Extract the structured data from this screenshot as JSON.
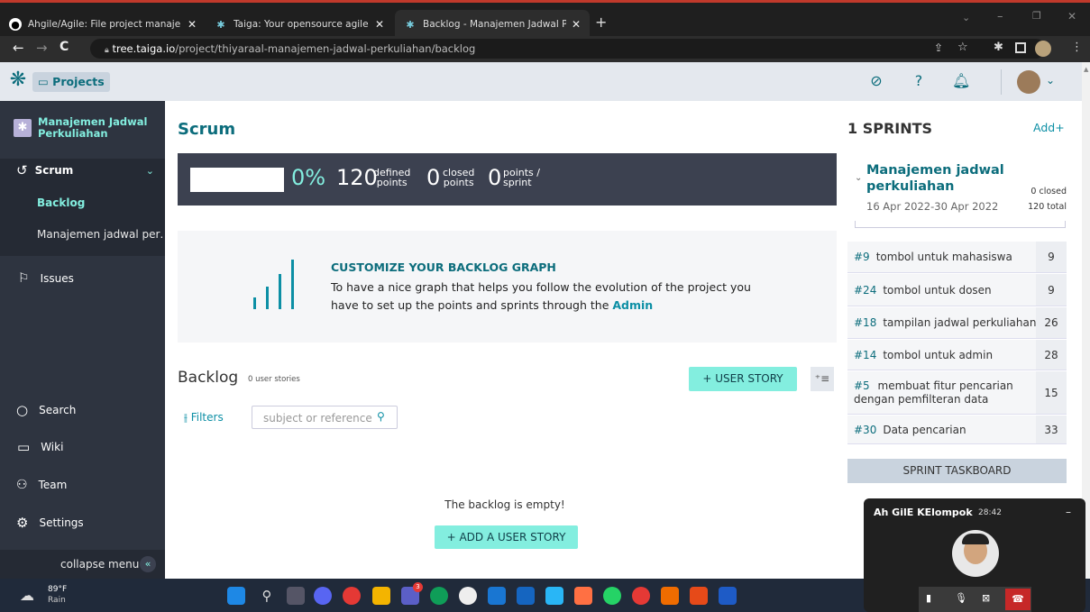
{
  "browser": {
    "tabs": [
      {
        "title": "Ahgile/Agile: File project manaje",
        "icon": "github-icon"
      },
      {
        "title": "Taiga: Your opensource agile proj",
        "icon": "taiga-icon"
      },
      {
        "title": "Backlog - Manajemen Jadwal Per",
        "icon": "taiga-icon"
      }
    ],
    "new_tab": "+",
    "url_host": "tree.taiga.io",
    "url_path": "/project/thiyaraal-manajemen-jadwal-perkuliahan/backlog"
  },
  "topnav": {
    "projects_label": "Projects"
  },
  "sidebar": {
    "project_name": "Manajemen Jadwal Perkuliahan",
    "scrum_label": "Scrum",
    "backlog_label": "Backlog",
    "sprint_label": "Manajemen jadwal per…",
    "issues_label": "Issues",
    "search_label": "Search",
    "wiki_label": "Wiki",
    "team_label": "Team",
    "settings_label": "Settings",
    "collapse_label": "collapse menu"
  },
  "main": {
    "title": "Scrum",
    "progress": {
      "percent": "0%",
      "defined_value": "120",
      "defined_label_1": "defined",
      "defined_label_2": "points",
      "closed_value": "0",
      "closed_label_1": "closed",
      "closed_label_2": "points",
      "sprint_value": "0",
      "sprint_label_1": "points /",
      "sprint_label_2": "sprint"
    },
    "graph": {
      "title": "CUSTOMIZE YOUR BACKLOG GRAPH",
      "text_1": "To have a nice graph that helps you follow the evolution of the project you",
      "text_2": "have to set up the points and sprints through the ",
      "admin_link": "Admin"
    },
    "backlog": {
      "title": "Backlog",
      "count": "0 user stories",
      "add_story": "+  USER STORY",
      "filters": "Filters",
      "search_placeholder": "subject or reference",
      "empty_text": "The backlog is empty!",
      "add_a_story": "+  ADD A USER STORY"
    }
  },
  "sprints": {
    "header": "1 SPRINTS",
    "add": "Add",
    "sprint_name_1": "Manajemen jadwal",
    "sprint_name_2": "perkuliahan",
    "dates": "16 Apr 2022-30 Apr 2022",
    "closed": "0 closed",
    "total": "120 total",
    "stories": [
      {
        "ref": "#9",
        "title": "tombol untuk mahasiswa",
        "points": "9"
      },
      {
        "ref": "#24",
        "title": "tombol untuk dosen",
        "points": "9"
      },
      {
        "ref": "#18",
        "title": "tampilan jadwal perkuliahan",
        "points": "26"
      },
      {
        "ref": "#14",
        "title": "tombol untuk admin",
        "points": "28"
      },
      {
        "ref": "#5",
        "title": "membuat fitur pencarian",
        "title2": "dengan pemfilteran data",
        "points": "15"
      },
      {
        "ref": "#30",
        "title": "Data pencarian",
        "points": "33"
      }
    ],
    "taskboard": "SPRINT TASKBOARD"
  },
  "video_call": {
    "title": "Ah GilE KElompok",
    "time": "28:42"
  },
  "taskbar": {
    "temp": "89°F",
    "weather": "Rain",
    "badge": "3"
  },
  "colors": {
    "accent": "#0c6d7c",
    "teal_button": "#83eedf",
    "sidebar_bg": "#2e3440",
    "active_link": "#83eedf"
  }
}
